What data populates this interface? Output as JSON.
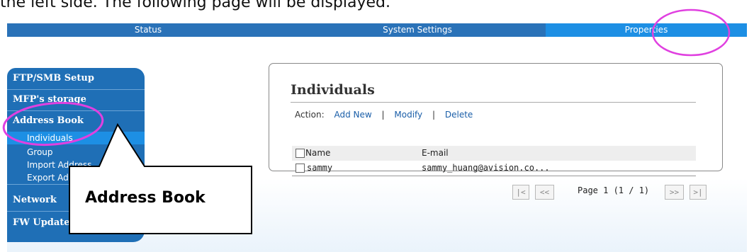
{
  "doc_text": "the left side. The following page will be displayed.",
  "topnav": {
    "tabs": [
      {
        "label": "Status"
      },
      {
        "label": "System Settings"
      },
      {
        "label": "Properties"
      }
    ]
  },
  "sidebar": {
    "items": [
      {
        "label": "FTP/SMB Setup"
      },
      {
        "label": "MFP's storage"
      },
      {
        "label": "Address Book"
      },
      {
        "label": "Network"
      },
      {
        "label": "FW Update"
      }
    ],
    "subitems": [
      {
        "label": "Individuals"
      },
      {
        "label": "Group"
      },
      {
        "label": "Import Address"
      },
      {
        "label": "Export Address"
      }
    ]
  },
  "panel": {
    "title": "Individuals",
    "action_label": "Action:",
    "actions": [
      "Add New",
      "Modify",
      "Delete"
    ],
    "separator": "|",
    "columns": [
      "Name",
      "E-mail"
    ],
    "rows": [
      {
        "name": "sammy",
        "email": "sammy_huang@avision.co..."
      }
    ]
  },
  "pager": {
    "first": "|<",
    "prev": "<<",
    "next": ">>",
    "last": ">|",
    "page_text": "Page 1 (1 / 1)"
  },
  "callout": {
    "label": "Address Book"
  },
  "colors": {
    "nav_blue": "#2a72b8",
    "nav_selected": "#1d8fe4",
    "sidebar_blue": "#1f6fb6",
    "highlight_magenta": "#e040e0",
    "link_blue": "#1a5ea8"
  }
}
